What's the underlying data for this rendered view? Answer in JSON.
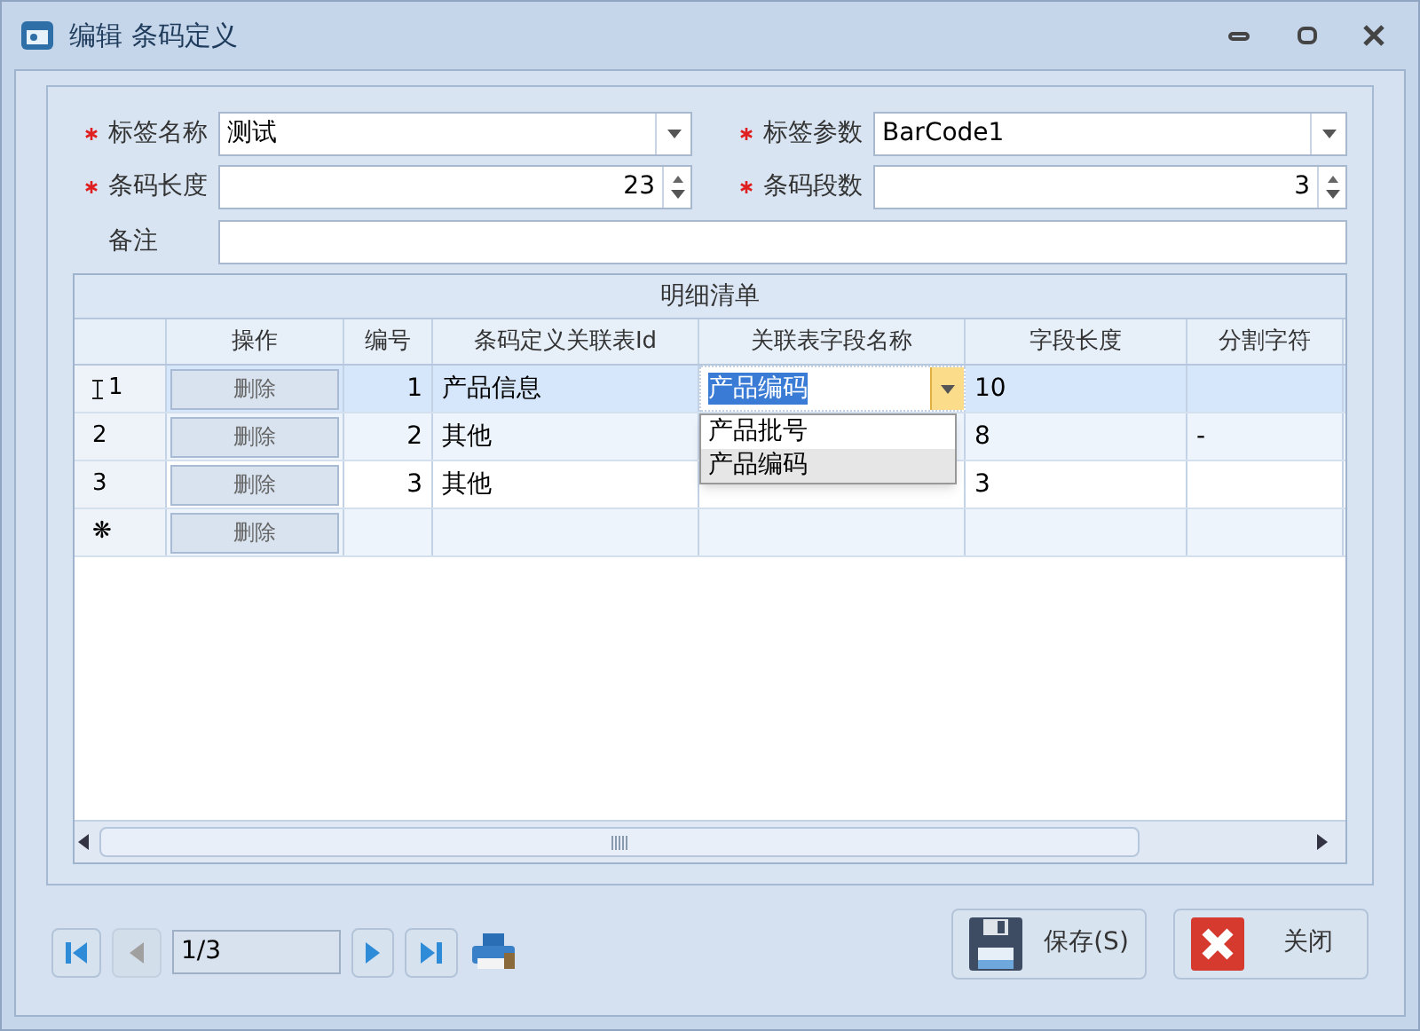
{
  "window": {
    "title": "编辑 条码定义"
  },
  "fields": [
    {
      "label": "标签名称",
      "required": true,
      "kind": "combo",
      "value": "测试"
    },
    {
      "label": "标签参数",
      "required": true,
      "kind": "combo",
      "value": "BarCode1"
    },
    {
      "label": "条码长度",
      "required": true,
      "kind": "spin",
      "value": "23"
    },
    {
      "label": "条码段数",
      "required": true,
      "kind": "spin",
      "value": "3"
    },
    {
      "label": "备注",
      "required": false,
      "kind": "text"
    }
  ],
  "grid": {
    "title": "明细清单",
    "columns": [
      "操作",
      "编号",
      "条码定义关联表Id",
      "关联表字段名称",
      "字段长度",
      "分割字符"
    ],
    "rows": [
      {
        "header": "1",
        "selected": true,
        "editing": true,
        "action": "删除",
        "cells": [
          "1",
          "产品信息",
          "产品编码",
          "10",
          ""
        ]
      },
      {
        "header": "2",
        "selected": false,
        "editing": false,
        "action": "删除",
        "cells": [
          "2",
          "其他",
          "",
          "8",
          "-"
        ]
      },
      {
        "header": "3",
        "selected": false,
        "editing": false,
        "action": "删除",
        "cells": [
          "3",
          "其他",
          "",
          "3",
          ""
        ]
      },
      {
        "header": "❋",
        "selected": false,
        "editing": false,
        "action": "删除",
        "cells": [
          "",
          "",
          "",
          "",
          ""
        ]
      }
    ],
    "dropdown": [
      {
        "label": "产品批号",
        "selected": false
      },
      {
        "label": "产品编码",
        "selected": true
      }
    ]
  },
  "navigator": {
    "position": "1/3"
  },
  "buttons": [
    {
      "kind": "save",
      "label": "保存(S)"
    },
    {
      "kind": "close",
      "label": "关闭"
    }
  ]
}
